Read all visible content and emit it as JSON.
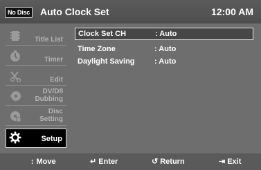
{
  "header": {
    "disc_badge": "No Disc",
    "title": "Auto Clock Set",
    "clock": "12:00 AM"
  },
  "sidebar": {
    "items": [
      {
        "label": "Title List",
        "icon": "title-list-icon",
        "active": false
      },
      {
        "label": "Timer",
        "icon": "timer-icon",
        "active": false
      },
      {
        "label": "Edit",
        "icon": "edit-icon",
        "active": false
      },
      {
        "label_line1": "DV/D8",
        "label_line2": "Dubbing",
        "icon": "dubbing-icon",
        "active": false
      },
      {
        "label_line1": "Disc",
        "label_line2": "Setting",
        "icon": "disc-setting-icon",
        "active": false
      },
      {
        "label": "Setup",
        "icon": "gear-icon",
        "active": true
      }
    ]
  },
  "settings": {
    "rows": [
      {
        "name": "Clock Set CH",
        "value": ": Auto",
        "selected": true
      },
      {
        "name": "Time Zone",
        "value": ": Auto",
        "selected": false
      },
      {
        "name": "Daylight Saving",
        "value": ": Auto",
        "selected": false
      }
    ]
  },
  "footer": {
    "move": "Move",
    "enter": "Enter",
    "return": "Return",
    "exit": "Exit"
  },
  "colors": {
    "background": "#6e6e6e",
    "header": "#4d4d4d",
    "selected_border": "#e6e6e6",
    "active_item_bg": "#000000",
    "text": "#ffffff",
    "inactive_label": "#b4b4b4"
  }
}
